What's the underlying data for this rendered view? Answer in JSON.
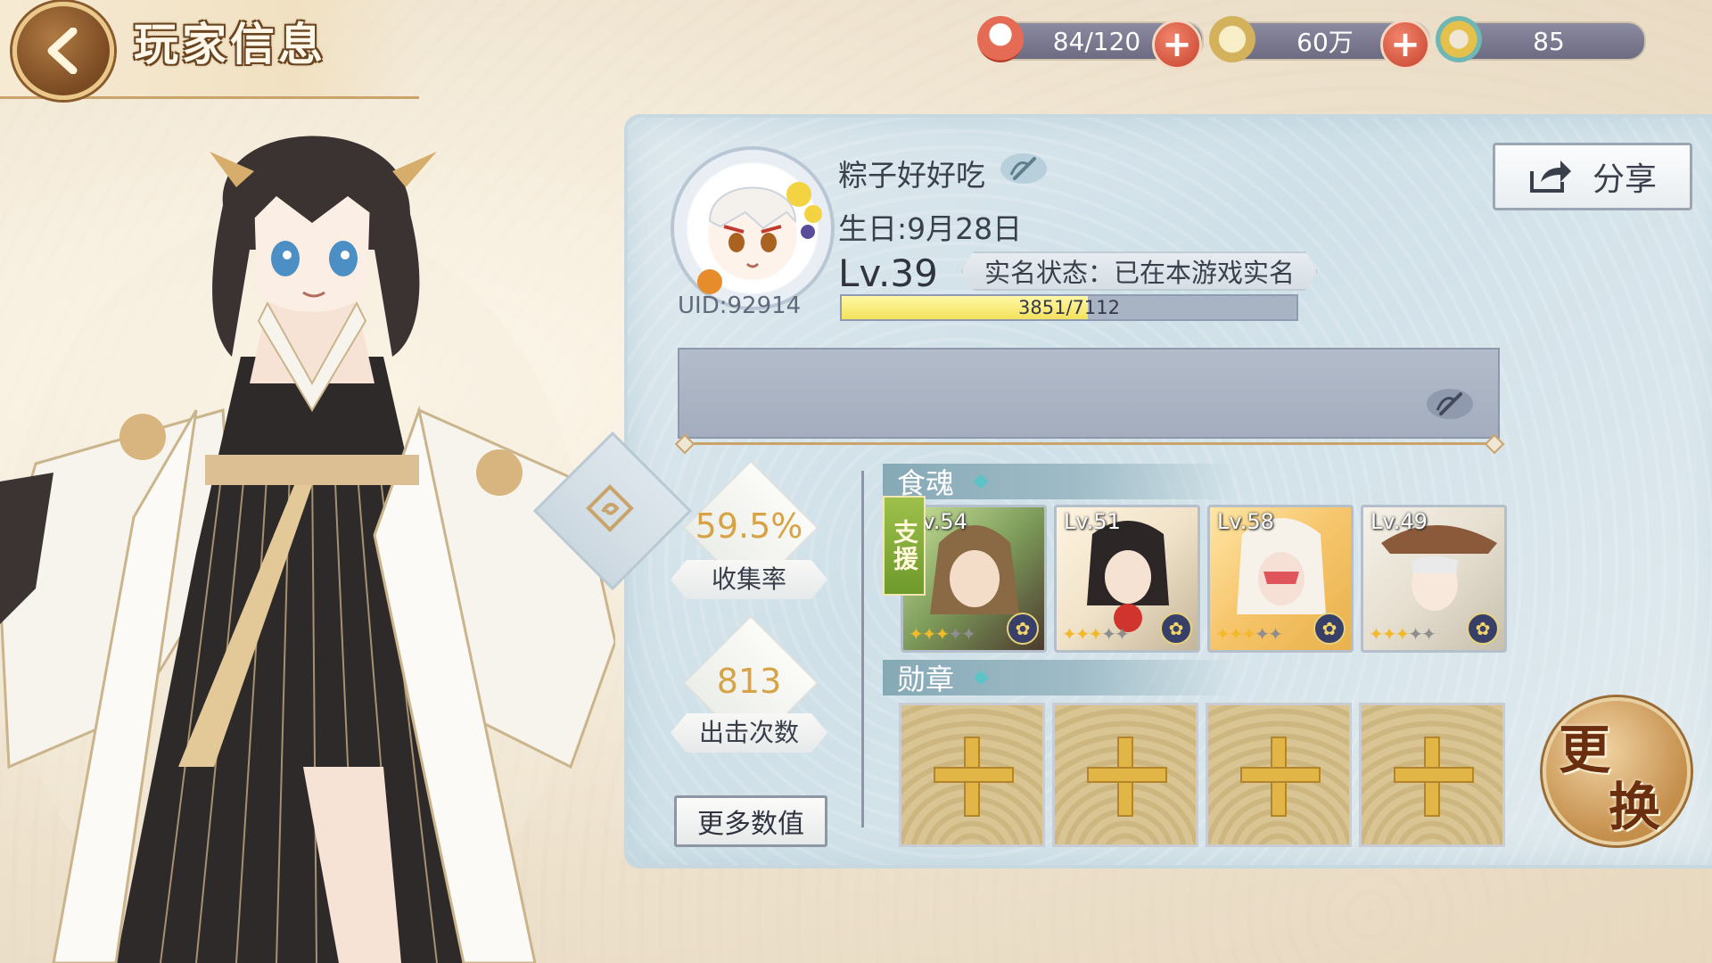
{
  "header": {
    "title": "玩家信息"
  },
  "resources": [
    {
      "name": "stamina",
      "value": "84/120",
      "icon": "rice-bowl-icon"
    },
    {
      "name": "gold",
      "value": "60万",
      "icon": "coin-icon"
    },
    {
      "name": "jade",
      "value": "85",
      "icon": "jade-ring-icon"
    }
  ],
  "profile": {
    "nickname": "粽子好好吃",
    "birthday": "生日:9月28日",
    "level": "Lv.39",
    "realname_status": "实名状态：已在本游戏实名",
    "exp_text": "3851/7112",
    "exp_current": 3851,
    "exp_max": 7112,
    "uid": "UID:92914"
  },
  "share_label": "分享",
  "stats": {
    "collection_rate": "59.5%",
    "collection_label": "收集率",
    "sorties": "813",
    "sorties_label": "出击次数",
    "more_label": "更多数值"
  },
  "soul_section": {
    "title": "食魂",
    "support_tag": "支援"
  },
  "souls": [
    {
      "level": "Lv.54",
      "stars": 3,
      "max_stars": 5
    },
    {
      "level": "Lv.51",
      "stars": 3,
      "max_stars": 5
    },
    {
      "level": "Lv.58",
      "stars": 3,
      "max_stars": 5
    },
    {
      "level": "Lv.49",
      "stars": 3,
      "max_stars": 5
    }
  ],
  "medal_section": {
    "title": "勋章",
    "slots": 4
  },
  "change_button": {
    "top": "更",
    "bottom": "换"
  },
  "colors": {
    "accent_gold": "#c9a36a",
    "panel_blue": "#cfe0e8",
    "exp_yellow": "#f3e25c"
  }
}
